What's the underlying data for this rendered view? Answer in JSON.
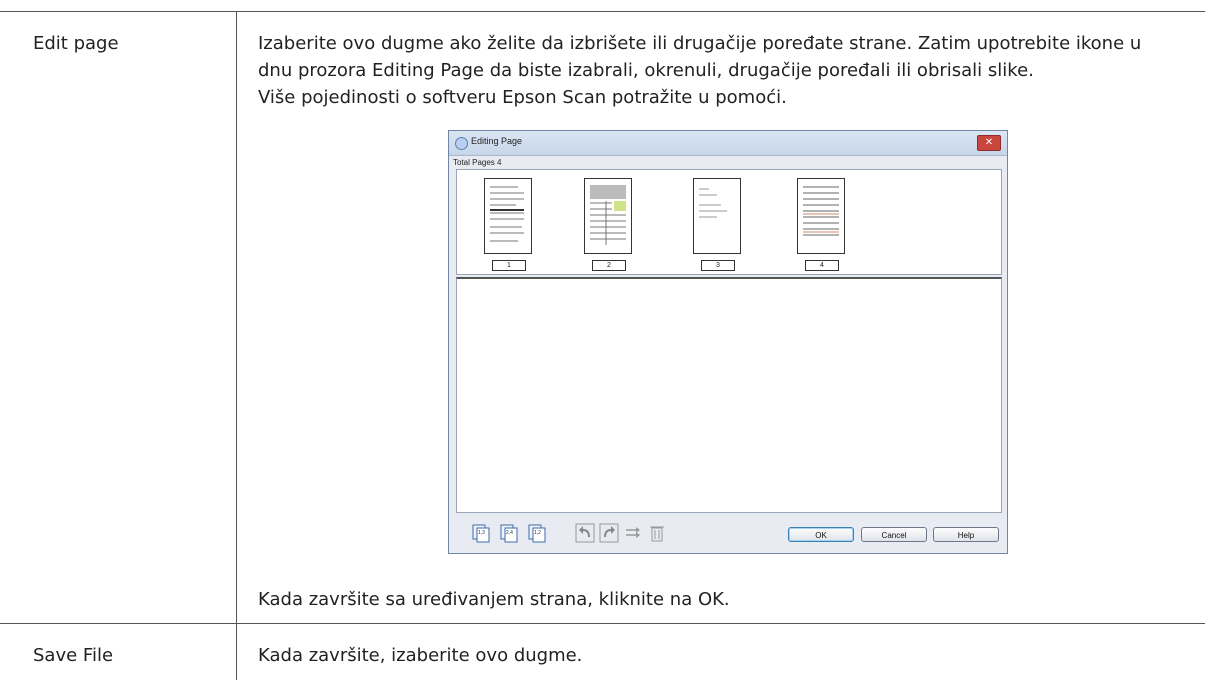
{
  "rows": [
    {
      "label": "Edit page",
      "lines": [
        "Izaberite ovo dugme ako želite da izbrišete ili drugačije poređate strane. Zatim upotrebite ikone u",
        "dnu prozora Editing Page da biste izabrali, okrenuli, drugačije poređali ili obrisali slike.",
        "Više pojedinosti o softveru Epson Scan potražite u pomoći."
      ],
      "after_text": "Kada završite sa uređivanjem strana, kliknite na OK."
    },
    {
      "label": "Save File",
      "lines": [
        "Kada završite, izaberite ovo dugme."
      ]
    }
  ],
  "dialog": {
    "title": "Editing Page",
    "close_icon": "close-icon",
    "total_pages_label": "Total Pages 4",
    "pages": [
      "1",
      "2",
      "3",
      "4"
    ],
    "toolbar_icons": [
      "select-odd-pages-icon",
      "select-even-pages-icon",
      "select-all-pages-icon",
      "rotate-left-icon",
      "rotate-right-icon",
      "move-page-icon",
      "delete-page-icon"
    ],
    "buttons": {
      "ok": "OK",
      "cancel": "Cancel",
      "help": "Help"
    }
  }
}
